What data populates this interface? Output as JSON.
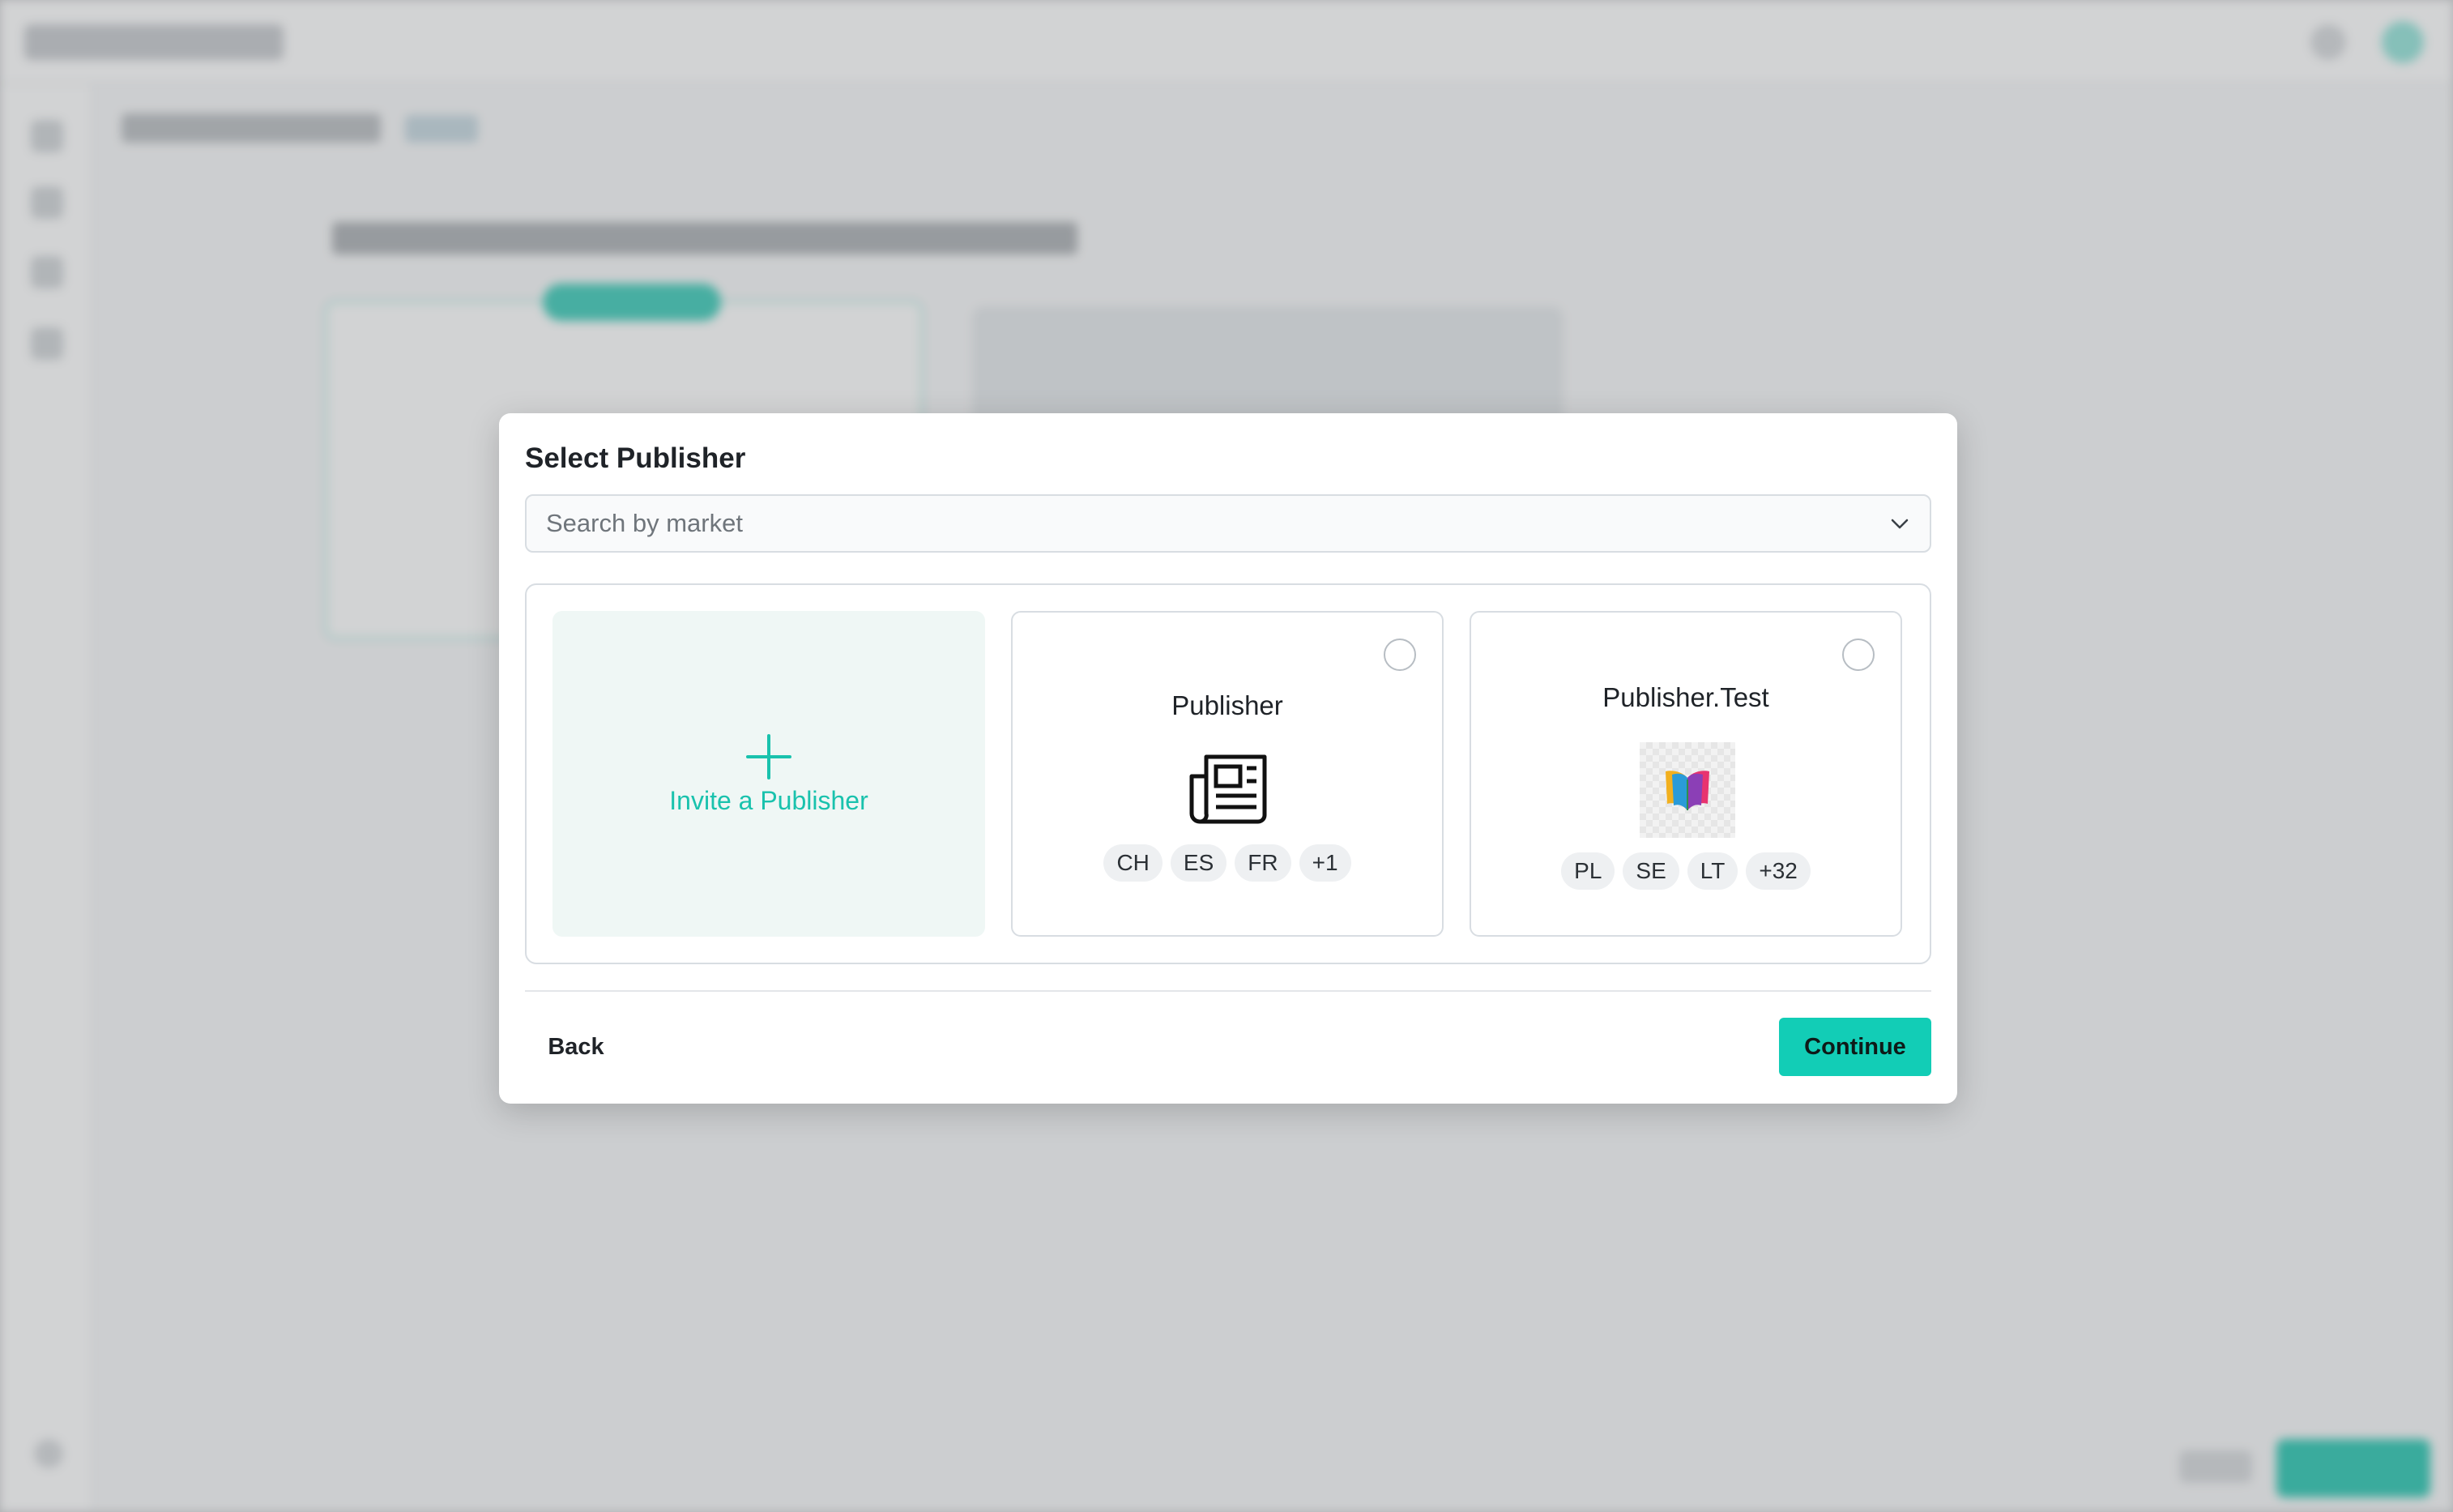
{
  "modal": {
    "title": "Select Publisher",
    "search": {
      "placeholder": "Search by market",
      "value": ""
    },
    "invite": {
      "label": "Invite a Publisher",
      "icon": "plus-icon"
    },
    "publishers": [
      {
        "name": "Publisher",
        "logo": "newspaper-icon",
        "selected": false,
        "markets": [
          "CH",
          "ES",
          "FR",
          "+1"
        ]
      },
      {
        "name": "Publisher.Test",
        "logo": "book-logo",
        "selected": false,
        "markets": [
          "PL",
          "SE",
          "LT",
          "+32"
        ]
      }
    ],
    "footer": {
      "back_label": "Back",
      "continue_label": "Continue"
    }
  },
  "colors": {
    "accent": "#12cdb6",
    "invite_text": "#19c2ad",
    "invite_bg": "#eff7f5",
    "border": "#d8dde2"
  }
}
